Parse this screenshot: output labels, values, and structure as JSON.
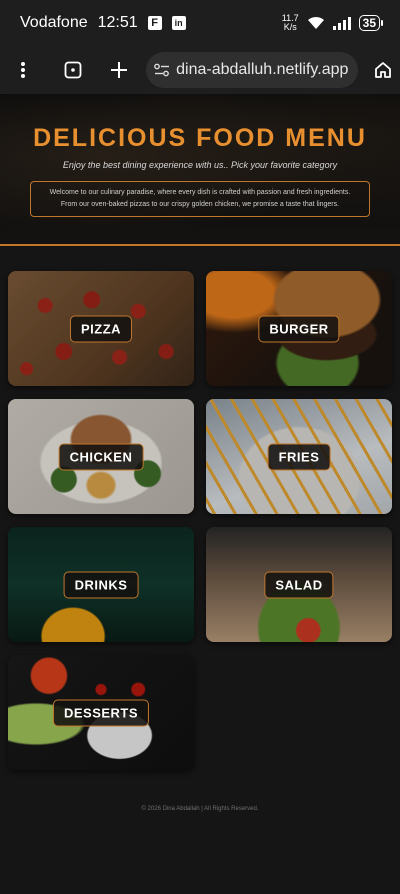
{
  "status_bar": {
    "carrier": "Vodafone",
    "time": "12:51",
    "app_icons": [
      "F",
      "in"
    ],
    "net_speed_value": "11.7",
    "net_speed_unit": "K/s",
    "battery": "35"
  },
  "browser": {
    "url": "dina-abdalluh.netlify.app"
  },
  "hero": {
    "title": "DELICIOUS FOOD MENU",
    "subtitle": "Enjoy the best dining experience with us.. Pick your favorite category",
    "description_line1": "Welcome to our culinary paradise, where every dish is crafted with passion and fresh ingredients.",
    "description_line2": "From our oven-baked pizzas to our crispy golden chicken, we promise a taste that lingers."
  },
  "categories": [
    {
      "label": "PIZZA"
    },
    {
      "label": "BURGER"
    },
    {
      "label": "CHICKEN"
    },
    {
      "label": "FRIES"
    },
    {
      "label": "DRINKS"
    },
    {
      "label": "SALAD"
    },
    {
      "label": "DESSERTS"
    }
  ],
  "footer": {
    "text": "© 2026 Dina Abdallah | All Rights Reserved."
  },
  "colors": {
    "accent": "#e8902f",
    "border_accent": "#c0772c",
    "background": "#151515"
  }
}
